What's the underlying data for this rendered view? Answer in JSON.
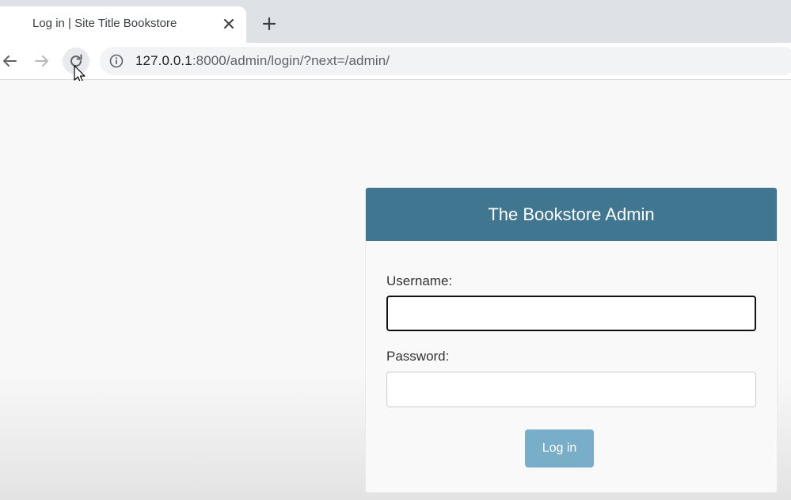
{
  "browser": {
    "tab_title": "Log in | Site Title Bookstore",
    "url_host": "127.0.0.1",
    "url_rest": ":8000/admin/login/?next=/admin/"
  },
  "icons": {
    "tab_close": "close-icon",
    "new_tab": "plus-icon",
    "back": "arrow-left-icon",
    "forward": "arrow-right-icon",
    "reload": "reload-icon",
    "site_info": "info-icon",
    "cursor": "mouse-pointer-icon"
  },
  "login": {
    "site_name": "The Bookstore Admin",
    "username_label": "Username:",
    "username_value": "",
    "password_label": "Password:",
    "password_value": "",
    "submit_label": "Log in"
  },
  "colors": {
    "header_bg": "#417690",
    "button_bg": "#79aec8",
    "tabstrip_bg": "#dee1e6"
  }
}
